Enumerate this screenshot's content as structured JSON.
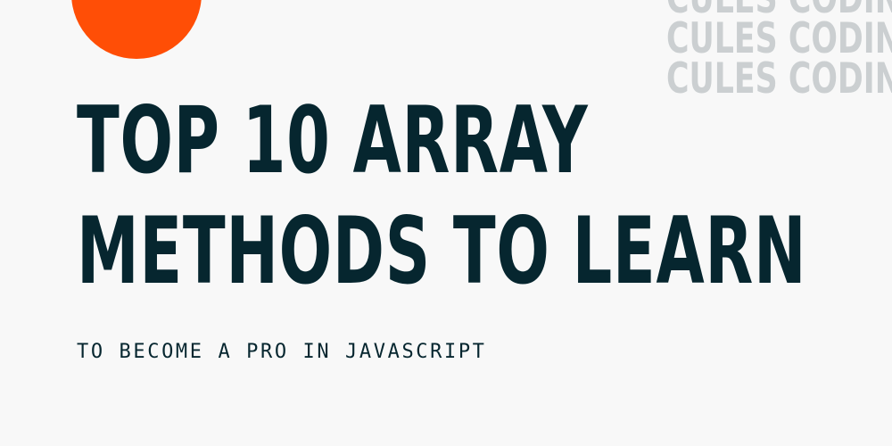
{
  "watermark": {
    "lines": [
      "CULES CODING",
      "CULES CODING",
      "CULES CODING"
    ]
  },
  "headline": {
    "line1": "TOP 10 ARRAY",
    "line2": "METHODS TO LEARN"
  },
  "subtitle": "TO BECOME A PRO IN JAVASCRIPT",
  "colors": {
    "background": "#f8f8f8",
    "accent_circle": "#ff4e06",
    "headline": "#06262f",
    "watermark": "#cbcfd1"
  }
}
